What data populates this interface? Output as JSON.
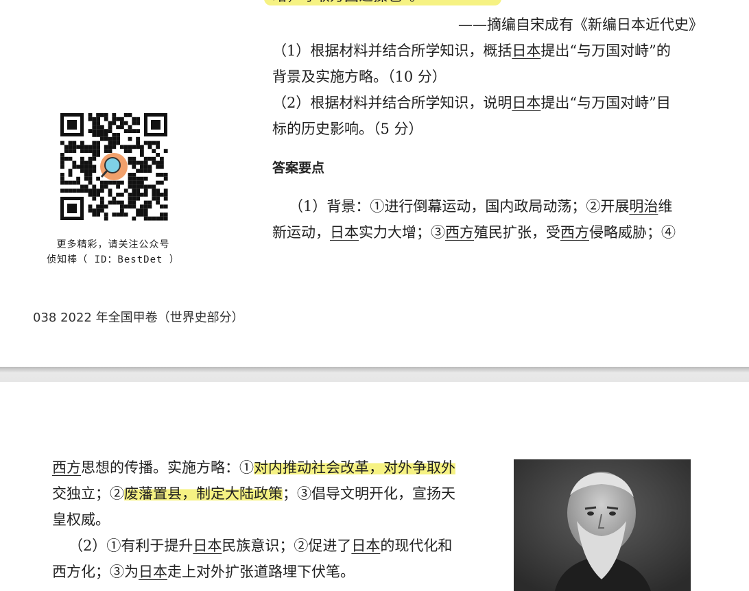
{
  "page1": {
    "top_fragment": "略，守取万国之操也”。",
    "citation": "——摘编自宋成有《新编日本近代史》",
    "q1": {
      "a": "（1）根据材料并结合所学知识，概括",
      "u": "日本",
      "b": "提出“与万国对峙”的",
      "c": "背景及实施方略。（10 分）"
    },
    "q2": {
      "a": "（2）根据材料并结合所学知识，说明",
      "u": "日本",
      "b": "提出“与万国对峙”目",
      "c": "标的历史影响。（5 分）"
    },
    "answer_heading": "答案要点",
    "ans1": {
      "a": "（1）背景：①进行倒幕运动，国内政局动荡；②开展",
      "u1": "明治",
      "b": "维",
      "c": "新运动，",
      "u2": "日本",
      "d": "实力大增；③",
      "u3": "西方",
      "e": "殖民扩张，受",
      "u4": "西方",
      "f": "侵略威胁；④"
    },
    "qr_caption_1": "更多精彩，请关注公众号",
    "qr_caption_2": "侦知棒（ ID：BestDet ）",
    "footer": "038  2022 年全国甲卷（世界史部分）"
  },
  "page2": {
    "l1": {
      "u": "西方",
      "a": "思想的传播。实施方略：①",
      "h": "对内推动社会改革，对外争取外"
    },
    "l2": {
      "a": "交独立；②",
      "h": "废藩置县，制定大陆政策",
      "b": "；③倡导文明开化，宣扬天"
    },
    "l3": "皇权威。",
    "l4": {
      "a": "（2）①有利于提升",
      "u1": "日本",
      "b": "民族意识；②促进了",
      "u2": "日本",
      "c": "的现代化和"
    },
    "l5": {
      "a": "西方化；③为",
      "u": "日本",
      "b": "走上对外扩张道路埋下伏笔。"
    }
  },
  "colors": {
    "highlight": "#f6f283",
    "text": "#222222",
    "page_gap": "#d0d0d0"
  }
}
